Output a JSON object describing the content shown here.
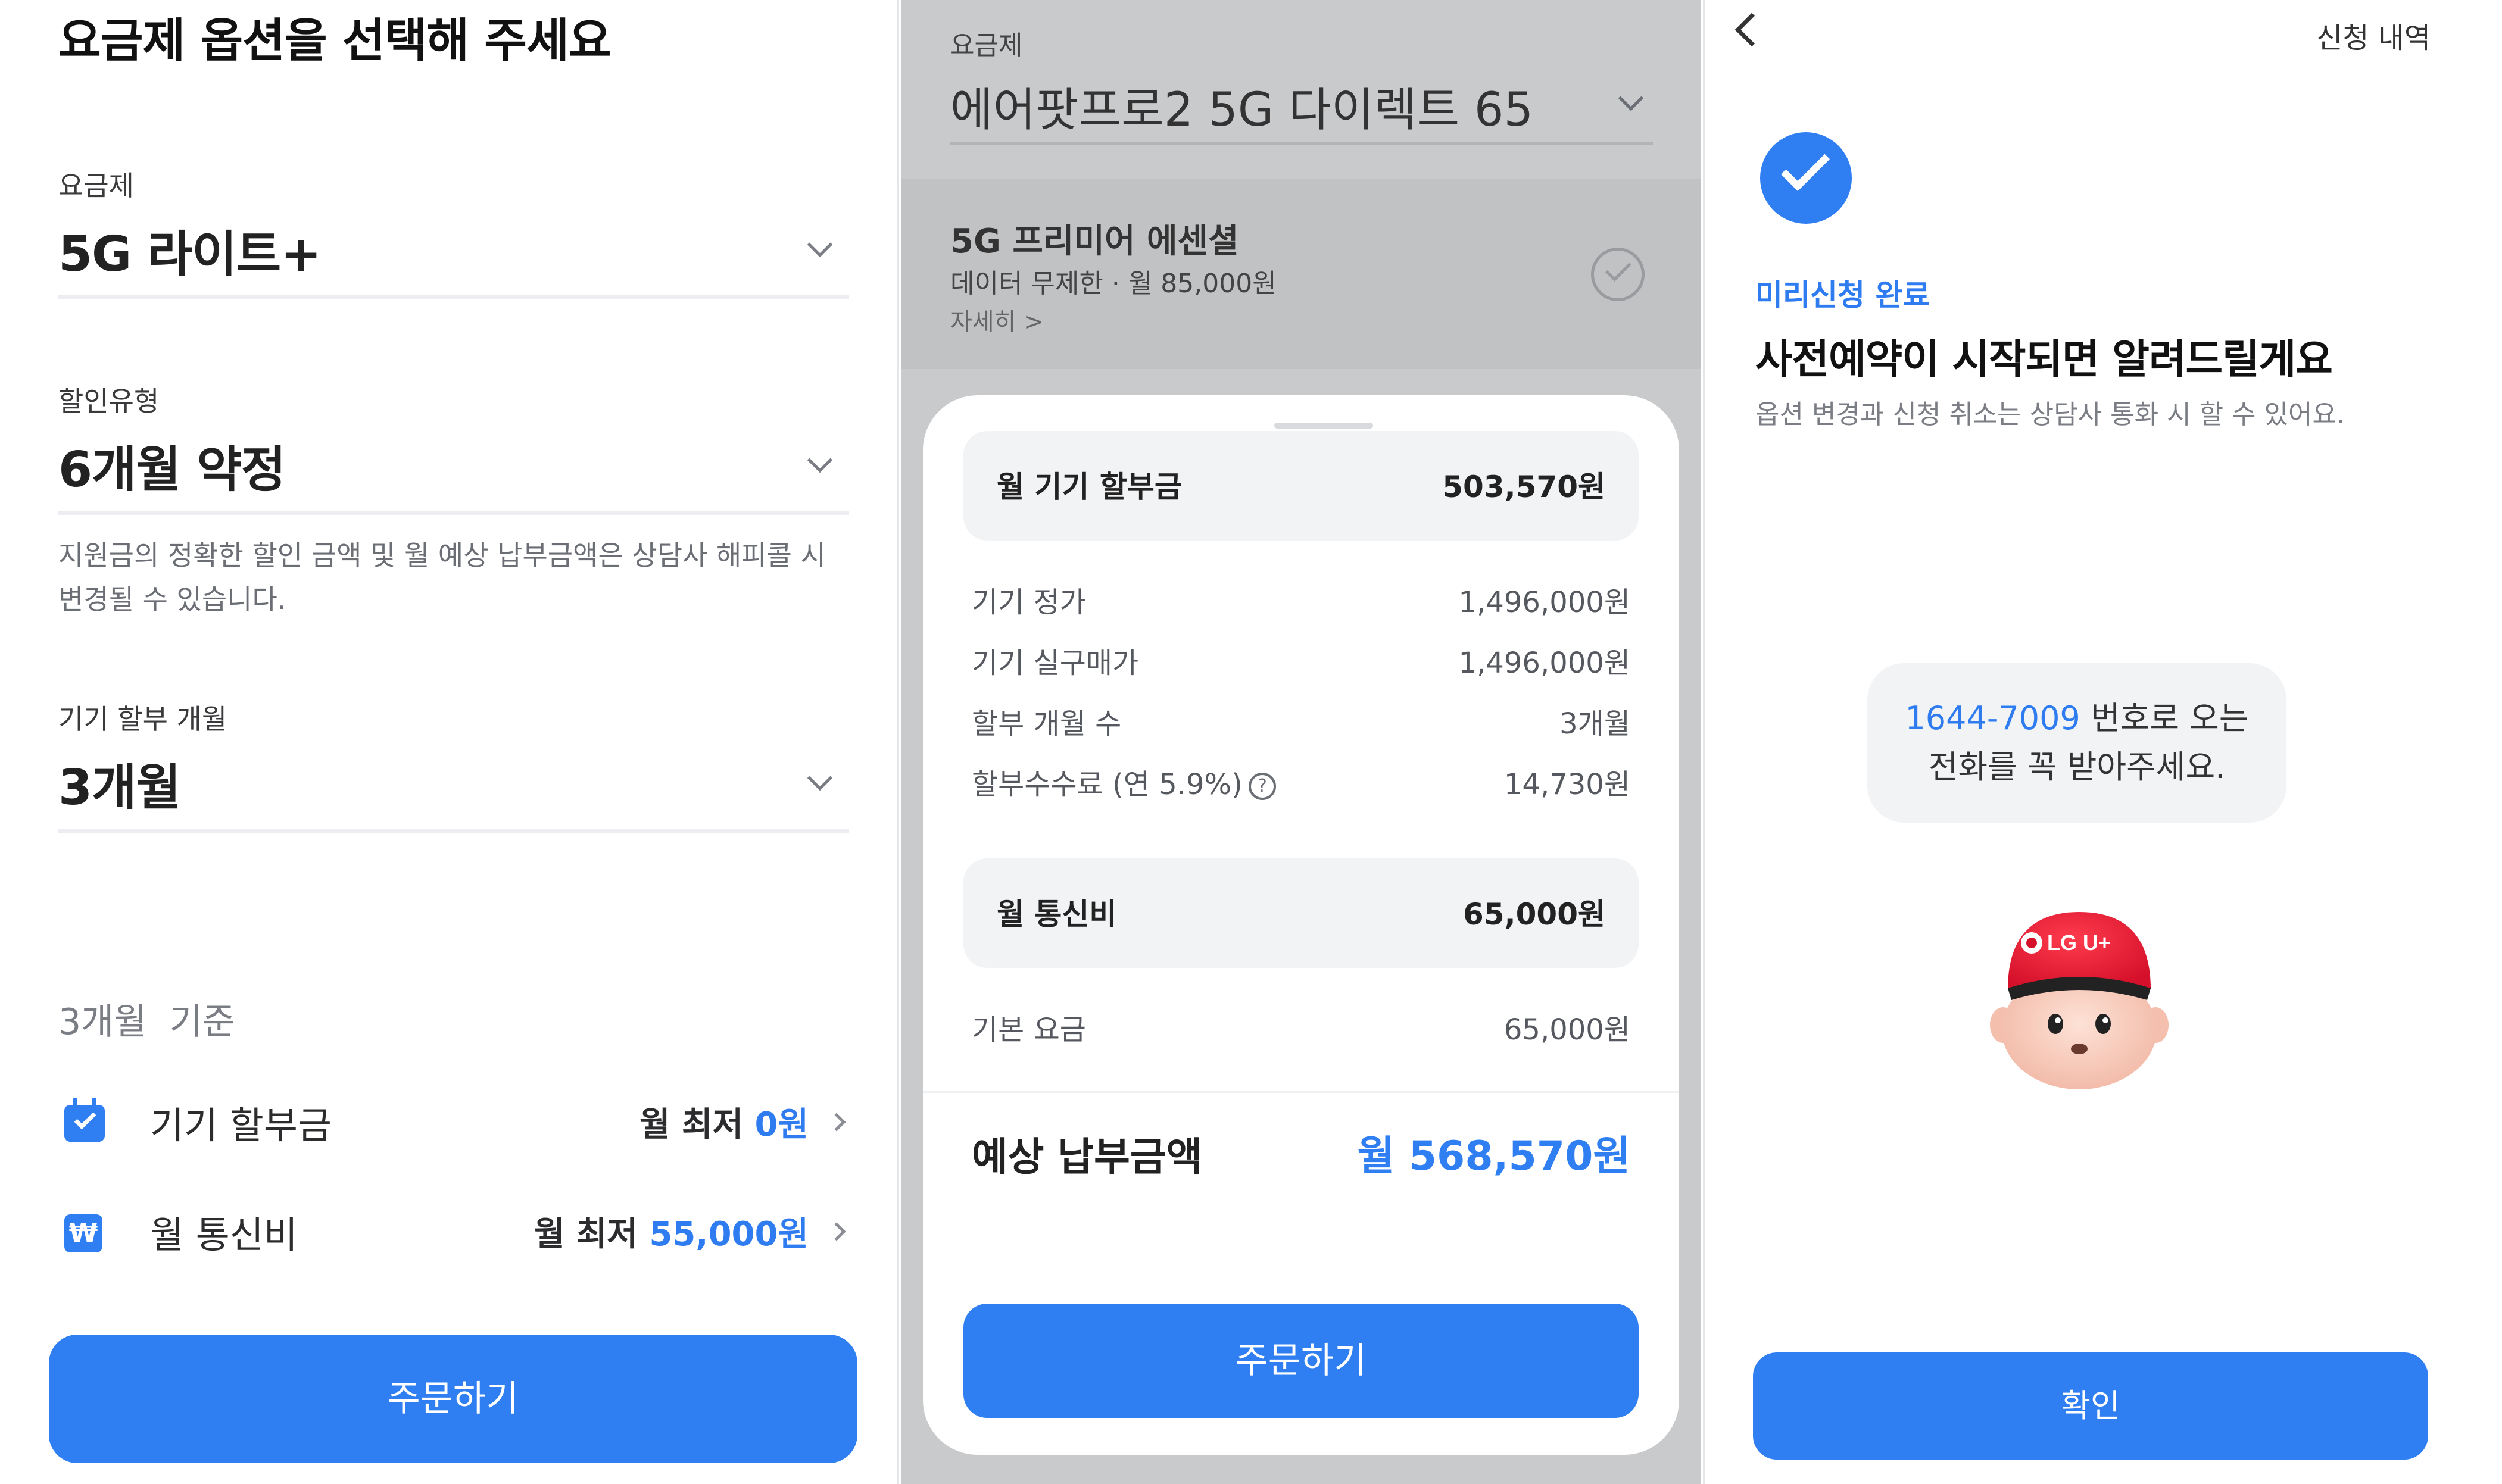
{
  "screen1": {
    "heading": "요금제 옵션을 선택해 주세요",
    "plan": {
      "label": "요금제",
      "value": "5G 라이트+"
    },
    "discount": {
      "label": "할인유형",
      "value": "6개월 약정"
    },
    "notice": "지원금의 정확한 할인 금액 및 월 예상 납부금액은 상담사 해피콜 시 변경될 수 있습니다.",
    "installment": {
      "label": "기기 할부 개월",
      "value": "3개월"
    },
    "basis": "3개월  기준",
    "device_payment": {
      "label": "기기 할부금",
      "prefix": "월 최저 ",
      "amount": "0원",
      "icon": "calendar-check-icon"
    },
    "monthly_fee": {
      "label": "월 통신비",
      "prefix": "월 최저 ",
      "amount": "55,000원",
      "icon": "won-receipt-icon"
    },
    "order_button": "주문하기",
    "accent_color": "#2f7ff2"
  },
  "screen2": {
    "plan_label": "요금제",
    "plan_value": "에어팟프로2 5G 다이렉트 65",
    "alt_plan": {
      "title": "5G 프리미어 에센셜",
      "sub": "데이터 무제한 · 월 85,000원",
      "link": "자세히 >"
    },
    "device_monthly": {
      "label": "월 기기 할부금",
      "value": "503,570원"
    },
    "rows": [
      {
        "label": "기기 정가",
        "value": "1,496,000원"
      },
      {
        "label": "기기 실구매가",
        "value": "1,496,000원"
      },
      {
        "label": "할부 개월 수",
        "value": "3개월"
      },
      {
        "label": "할부수수료 (연 5.9%)",
        "value": "14,730원"
      }
    ],
    "telecom_monthly": {
      "label": "월 통신비",
      "value": "65,000원"
    },
    "base_fee": {
      "label": "기본 요금",
      "value": "65,000원"
    },
    "total": {
      "label": "예상 납부금액",
      "value": "월 568,570원"
    },
    "order_button": "주문하기"
  },
  "screen3": {
    "history_link": "신청 내역",
    "status": "미리신청 완료",
    "title": "사전예약이 시작되면 알려드릴게요",
    "sub": "옵션 변경과 신청 취소는 상담사 통화 시 할 수 있어요.",
    "bubble_number": "1644-7009",
    "bubble_line1_rest": " 번호로 오는",
    "bubble_line2": "전화를 꼭 받아주세요.",
    "mascot_logo": "LG U+",
    "confirm_button": "확인"
  }
}
